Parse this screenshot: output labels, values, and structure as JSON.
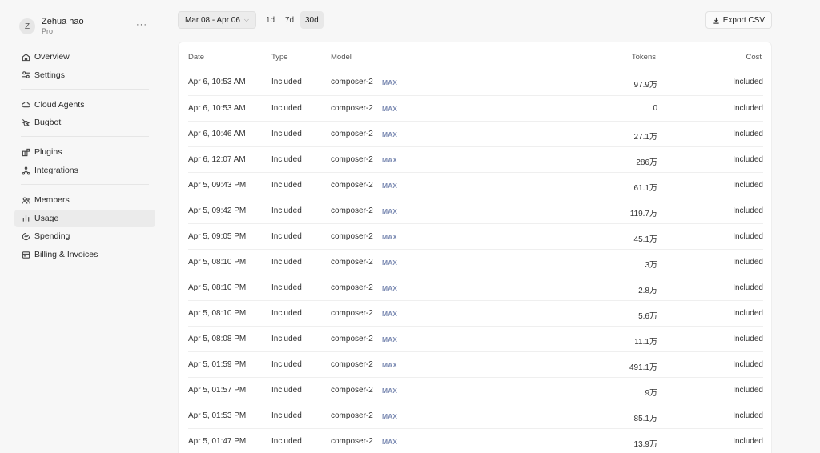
{
  "user": {
    "initial": "Z",
    "name": "Zehua hao",
    "plan": "Pro",
    "more": "···"
  },
  "nav": {
    "group1": [
      {
        "label": "Overview",
        "icon": "home-icon"
      },
      {
        "label": "Settings",
        "icon": "settings-sliders-icon"
      }
    ],
    "group2": [
      {
        "label": "Cloud Agents",
        "icon": "cloud-icon"
      },
      {
        "label": "Bugbot",
        "icon": "bug-icon"
      }
    ],
    "group3": [
      {
        "label": "Plugins",
        "icon": "plugin-icon"
      },
      {
        "label": "Integrations",
        "icon": "integrations-icon"
      }
    ],
    "group4": [
      {
        "label": "Members",
        "icon": "members-icon"
      },
      {
        "label": "Usage",
        "icon": "bar-chart-icon",
        "active": true
      },
      {
        "label": "Spending",
        "icon": "spending-icon"
      },
      {
        "label": "Billing & Invoices",
        "icon": "invoice-icon"
      }
    ]
  },
  "toolbar": {
    "date_range": "Mar 08 - Apr 06",
    "range_1d": "1d",
    "range_7d": "7d",
    "range_30d": "30d",
    "export_label": "Export CSV"
  },
  "table": {
    "headers": {
      "date": "Date",
      "type": "Type",
      "model": "Model",
      "tokens": "Tokens",
      "cost": "Cost"
    },
    "rows": [
      {
        "date": "Apr 6, 10:53 AM",
        "type": "Included",
        "model": "composer-2",
        "badge": "MAX",
        "tokens": "97.9万",
        "cost": "Included"
      },
      {
        "date": "Apr 6, 10:53 AM",
        "type": "Included",
        "model": "composer-2",
        "badge": "MAX",
        "tokens": "0",
        "cost": "Included"
      },
      {
        "date": "Apr 6, 10:46 AM",
        "type": "Included",
        "model": "composer-2",
        "badge": "MAX",
        "tokens": "27.1万",
        "cost": "Included"
      },
      {
        "date": "Apr 6, 12:07 AM",
        "type": "Included",
        "model": "composer-2",
        "badge": "MAX",
        "tokens": "286万",
        "cost": "Included"
      },
      {
        "date": "Apr 5, 09:43 PM",
        "type": "Included",
        "model": "composer-2",
        "badge": "MAX",
        "tokens": "61.1万",
        "cost": "Included"
      },
      {
        "date": "Apr 5, 09:42 PM",
        "type": "Included",
        "model": "composer-2",
        "badge": "MAX",
        "tokens": "119.7万",
        "cost": "Included"
      },
      {
        "date": "Apr 5, 09:05 PM",
        "type": "Included",
        "model": "composer-2",
        "badge": "MAX",
        "tokens": "45.1万",
        "cost": "Included"
      },
      {
        "date": "Apr 5, 08:10 PM",
        "type": "Included",
        "model": "composer-2",
        "badge": "MAX",
        "tokens": "3万",
        "cost": "Included"
      },
      {
        "date": "Apr 5, 08:10 PM",
        "type": "Included",
        "model": "composer-2",
        "badge": "MAX",
        "tokens": "2.8万",
        "cost": "Included"
      },
      {
        "date": "Apr 5, 08:10 PM",
        "type": "Included",
        "model": "composer-2",
        "badge": "MAX",
        "tokens": "5.6万",
        "cost": "Included"
      },
      {
        "date": "Apr 5, 08:08 PM",
        "type": "Included",
        "model": "composer-2",
        "badge": "MAX",
        "tokens": "11.1万",
        "cost": "Included"
      },
      {
        "date": "Apr 5, 01:59 PM",
        "type": "Included",
        "model": "composer-2",
        "badge": "MAX",
        "tokens": "491.1万",
        "cost": "Included"
      },
      {
        "date": "Apr 5, 01:57 PM",
        "type": "Included",
        "model": "composer-2",
        "badge": "MAX",
        "tokens": "9万",
        "cost": "Included"
      },
      {
        "date": "Apr 5, 01:53 PM",
        "type": "Included",
        "model": "composer-2",
        "badge": "MAX",
        "tokens": "85.1万",
        "cost": "Included"
      },
      {
        "date": "Apr 5, 01:47 PM",
        "type": "Included",
        "model": "composer-2",
        "badge": "MAX",
        "tokens": "13.9万",
        "cost": "Included"
      }
    ]
  }
}
